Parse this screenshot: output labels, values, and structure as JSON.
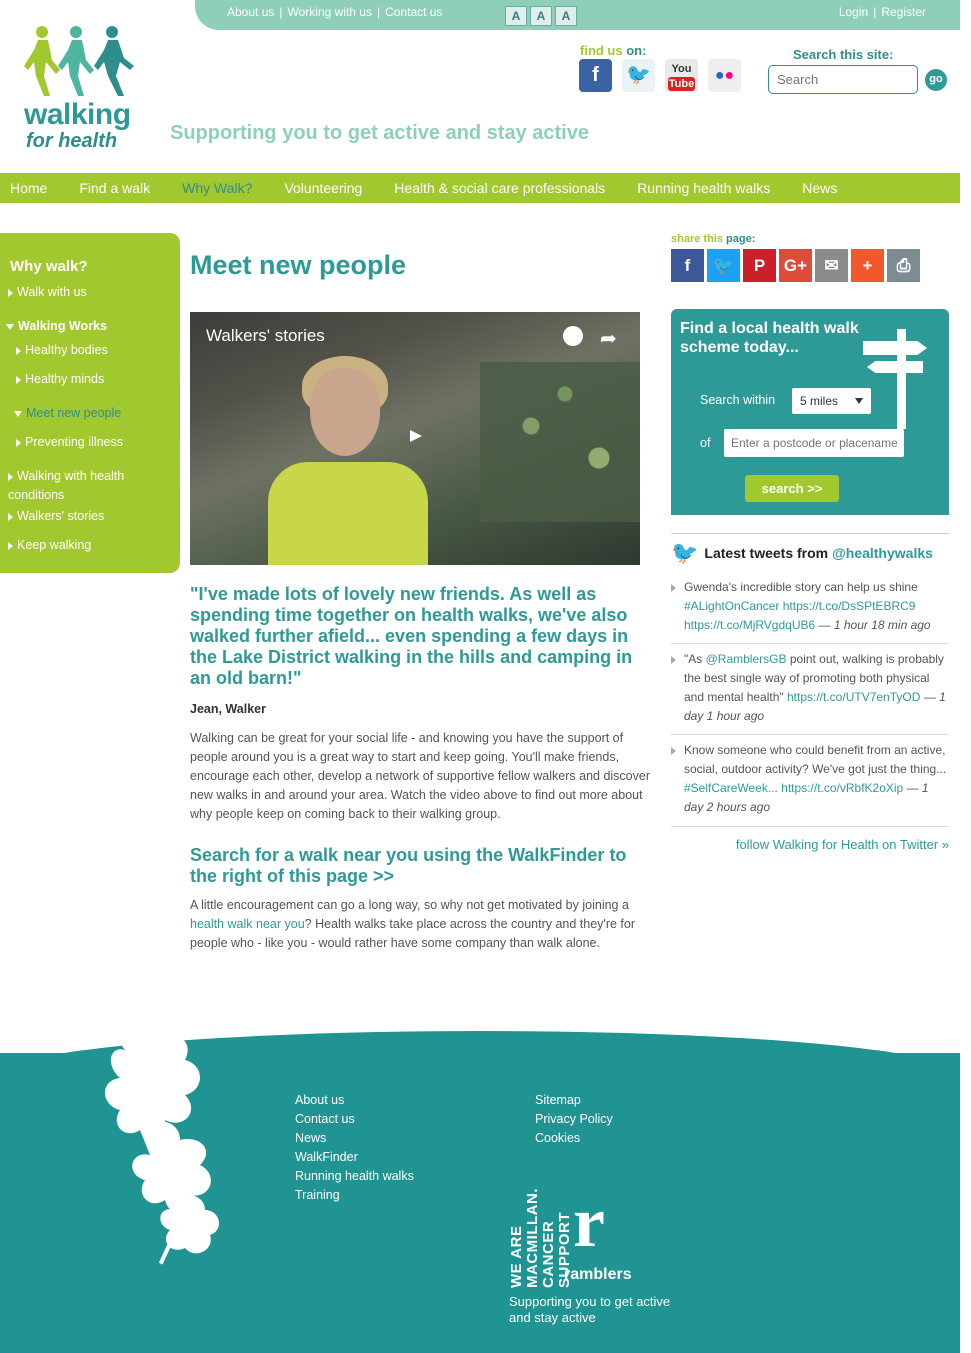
{
  "top": {
    "links": [
      "About us",
      "Working with us",
      "Contact us"
    ],
    "text_size": [
      "A",
      "A",
      "A"
    ],
    "login": "Login",
    "register": "Register"
  },
  "brand": {
    "word1": "walking",
    "word2": "for health",
    "tagline": "Supporting you to get active and stay active"
  },
  "find_us": {
    "prefix": "find us",
    "suffix": "on:"
  },
  "social_top": [
    "facebook-icon",
    "twitter-icon",
    "youtube-icon",
    "flickr-icon"
  ],
  "search": {
    "label": "Search this site:",
    "placeholder": "Search",
    "go": "go"
  },
  "nav": [
    "Home",
    "Find a walk",
    "Why Walk?",
    "Volunteering",
    "Health & social care professionals",
    "Running health walks",
    "News"
  ],
  "sidebar": {
    "title": "Why walk?",
    "items": [
      "Walk with us",
      "Walking Works",
      "Healthy bodies",
      "Healthy minds",
      "Meet new people",
      "Preventing illness",
      "Walking with health conditions",
      "Walkers' stories",
      "Keep walking"
    ]
  },
  "main": {
    "title": "Meet new people",
    "video_title": "Walkers' stories",
    "quote": "\"I've made lots of lovely new friends. As well as spending time together on health walks, we've also walked further afield... even spending a few days in the Lake District walking in the hills and camping in an old barn!\"",
    "quote_by": "Jean, Walker",
    "para1": "Walking can be great for your social life - and knowing you have the support of people around you is a great way to start and keep going. You'll make friends, encourage each other, develop a network of supportive fellow walkers and discover new walks in and around your area. Watch the video above to find out more about why people keep on coming back to their walking group.",
    "subhead": "Search for a walk near you using the WalkFinder to the right of this page >>",
    "para2_a": "A little encouragement can go a long way, so why not get motivated by joining a ",
    "para2_link": "health walk near you",
    "para2_b": "? Health walks take place across the country and they're for people who - like you - would rather have some company than walk alone."
  },
  "share": {
    "prefix": "share",
    "mid": "this",
    "suffix": "page:"
  },
  "finder": {
    "title": "Find a local health walk scheme today...",
    "within_label": "Search within",
    "within_value": "5 miles",
    "of_label": "of",
    "postcode_placeholder": "Enter a postcode or placename",
    "button": "search >>"
  },
  "tweets": {
    "heading": "Latest tweets from",
    "handle": "@healthywalks",
    "items": [
      {
        "t1": "Gwenda's incredible story can help us shine ",
        "l1": "#ALightOnCancer",
        "t2": " ",
        "l2": "https://t.co/DsSPtEBRC9",
        "t3": " ",
        "l3": "https://t.co/MjRVgdqUB6",
        "time": "1 hour 18 min ago"
      },
      {
        "t1": "\"As ",
        "l1": "@RamblersGB",
        "t2": " point out, walking is probably the best single way of promoting both physical and mental health\" ",
        "l2": "https://t.co/UTV7enTyOD",
        "t3": "",
        "l3": "",
        "time": "1 day 1 hour ago"
      },
      {
        "t1": "Know someone who could benefit from an active, social, outdoor activity? We've got just the thing... ",
        "l1": "#SelfCareWeek...",
        "t2": " ",
        "l2": "https://t.co/vRbfK2oXip",
        "t3": "",
        "l3": "",
        "time": "1 day 2 hours ago"
      }
    ],
    "follow": "follow Walking for Health on Twitter »"
  },
  "footer": {
    "col1": [
      "About us",
      "Contact us",
      "News",
      "WalkFinder",
      "Running health walks",
      "Training"
    ],
    "col2": [
      "Sitemap",
      "Privacy Policy",
      "Cookies"
    ],
    "macmillan": "WE ARE MACMILLAN. CANCER SUPPORT",
    "ramblers_mark": "r",
    "ramblers": "ramblers",
    "tagline": "Supporting you to get active and stay active"
  },
  "colors": {
    "teal": "#2e9a97",
    "green": "#a2c830",
    "mint": "#8dd0b7",
    "footer": "#1f9493"
  }
}
